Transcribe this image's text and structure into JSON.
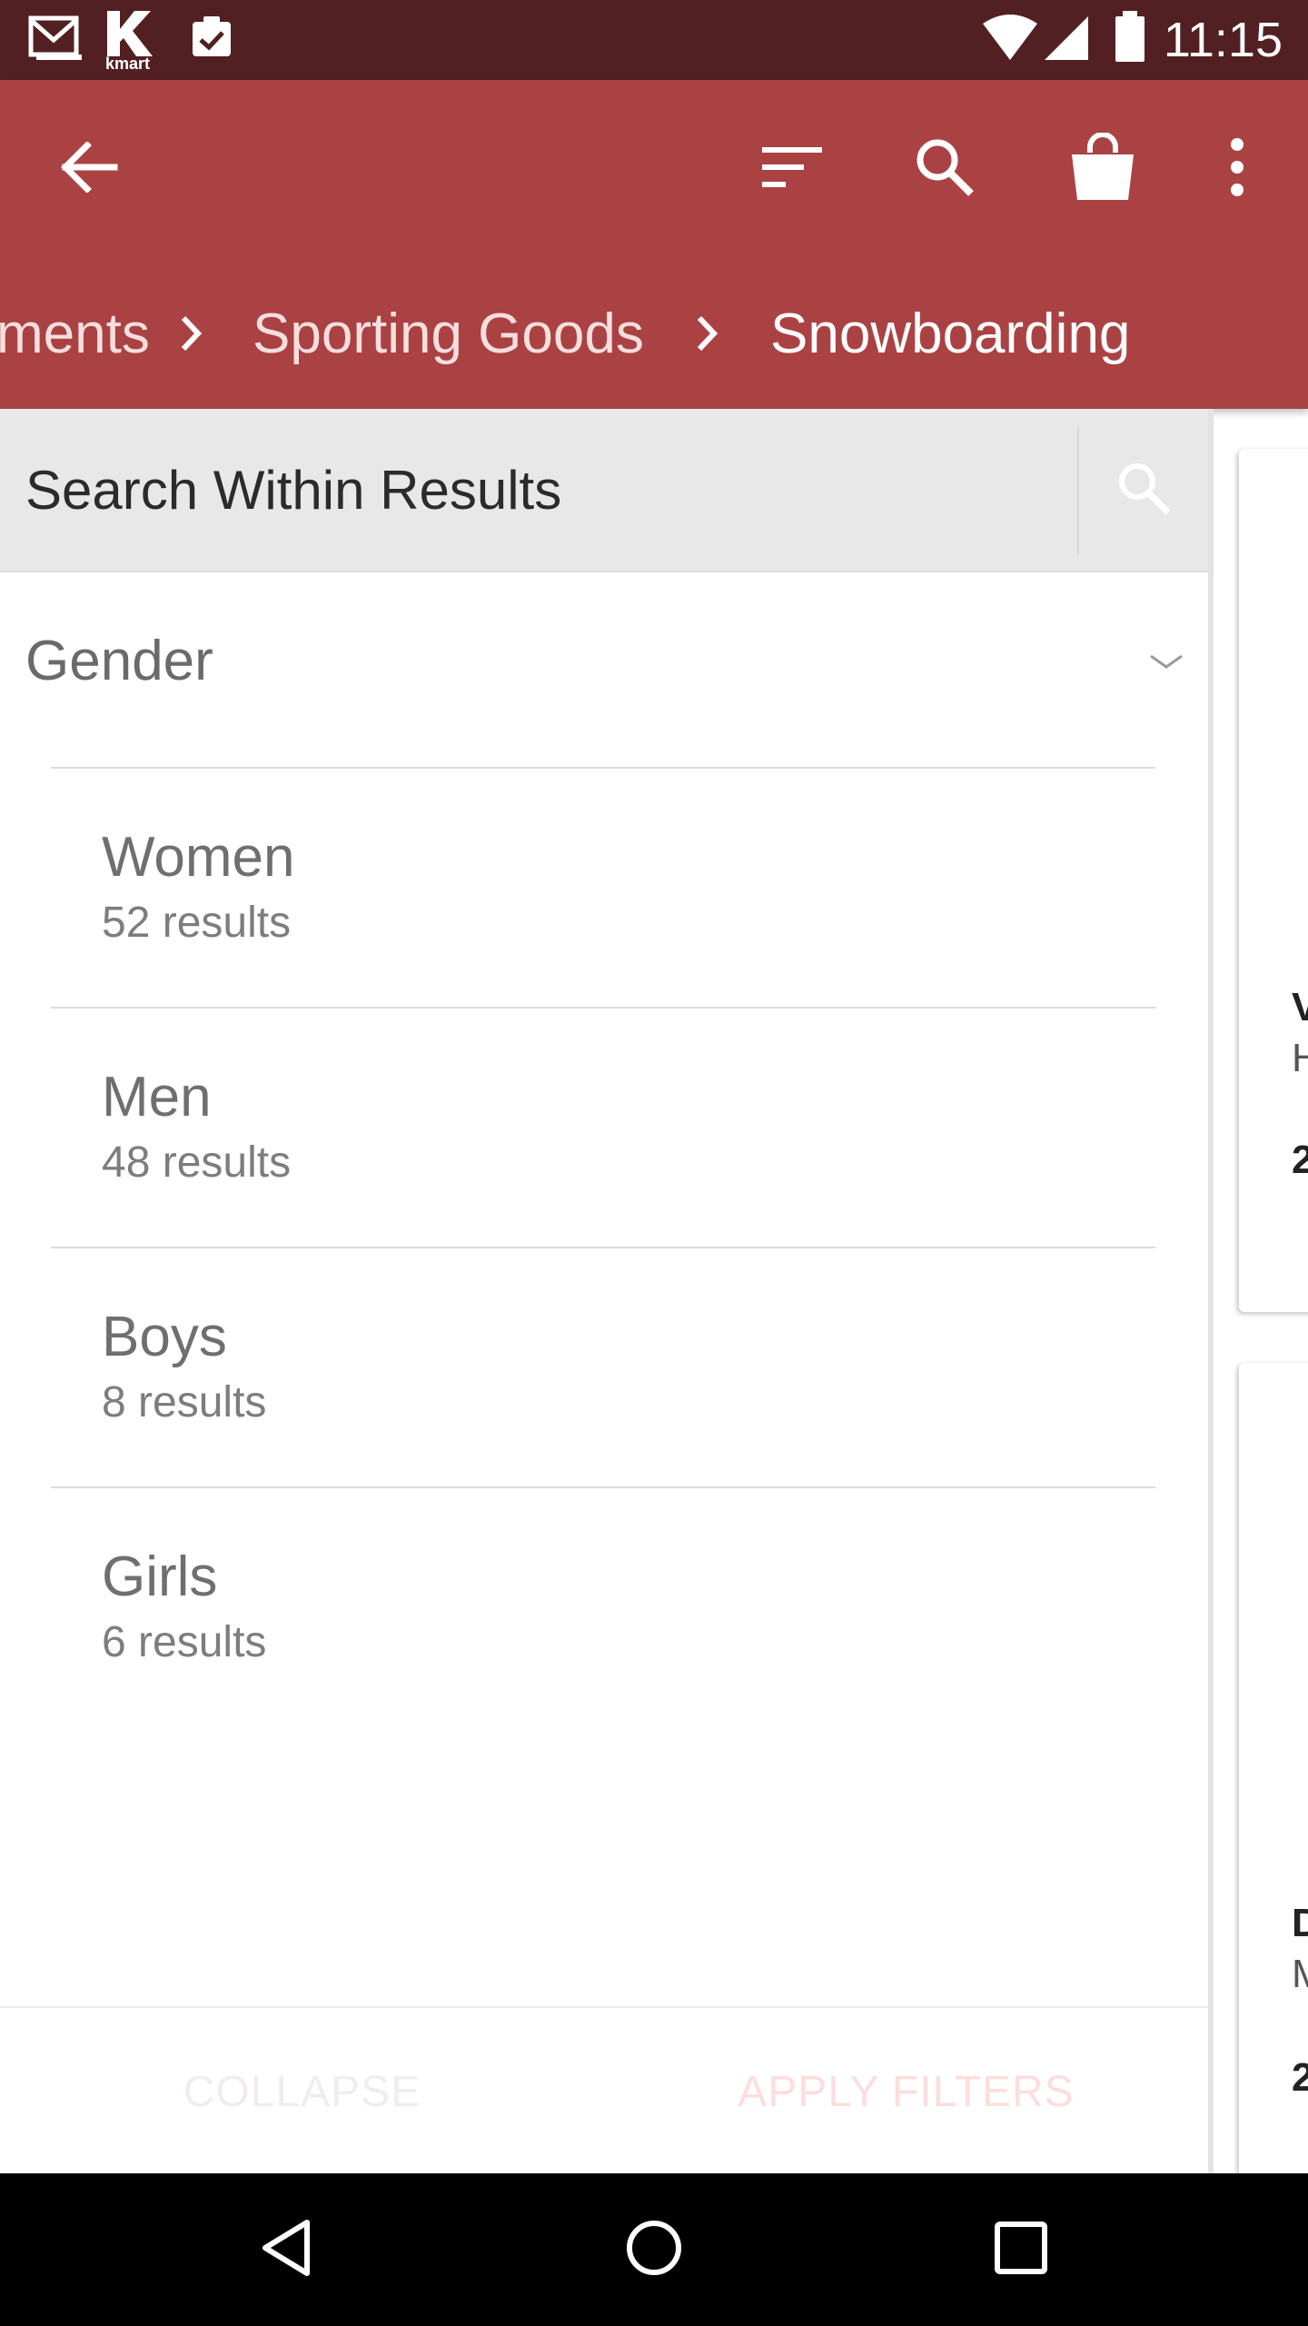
{
  "status_bar": {
    "time": "11:15",
    "icons": [
      "gmail-icon",
      "kmart-icon",
      "clipboard-check-icon",
      "wifi-icon",
      "cell-signal-icon",
      "battery-icon"
    ],
    "kmart_text": "kmart"
  },
  "app_bar": {
    "color": "#aa4243",
    "icons": [
      "back-arrow-icon",
      "sort-icon",
      "search-icon",
      "shopping-bag-icon",
      "more-vert-icon"
    ],
    "breadcrumb": [
      "ments",
      "Sporting Goods",
      "Snowboarding"
    ]
  },
  "filter_panel": {
    "search": {
      "placeholder": "Search Within Results"
    },
    "gender": {
      "title": "Gender",
      "options": [
        {
          "label": "Women",
          "count": "52 results"
        },
        {
          "label": "Men",
          "count": "48 results"
        },
        {
          "label": "Boys",
          "count": "8 results"
        },
        {
          "label": "Girls",
          "count": "6 results"
        }
      ]
    },
    "footer": {
      "collapse_label": "COLLAPSE",
      "apply_label": "APPLY FILTERS"
    }
  },
  "product_peek": {
    "cards": [
      {
        "line1": "V",
        "line2": "H",
        "line3": "2"
      },
      {
        "line1": "D",
        "line2": "M",
        "line3": "2"
      }
    ]
  },
  "nav_bar": {
    "icons": [
      "back-triangle-icon",
      "home-circle-icon",
      "recents-square-icon"
    ]
  }
}
